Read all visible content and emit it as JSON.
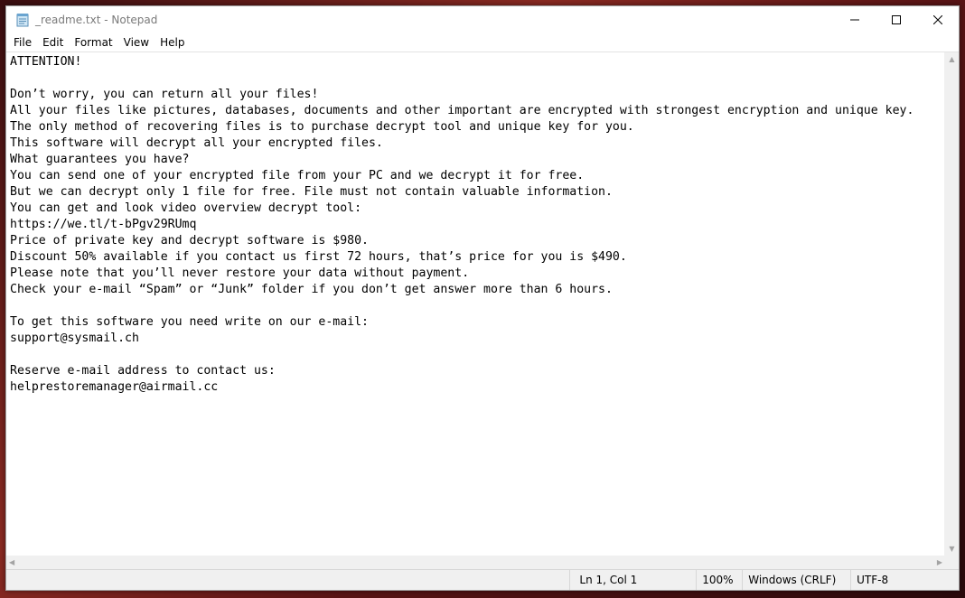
{
  "window": {
    "title": "_readme.txt - Notepad",
    "icon": "notepad-icon",
    "controls": [
      "minimize-icon",
      "maximize-icon",
      "close-icon"
    ]
  },
  "menu": {
    "file": "File",
    "edit": "Edit",
    "format": "Format",
    "view": "View",
    "help": "Help"
  },
  "document": {
    "text": "ATTENTION!\n\nDon’t worry, you can return all your files!\nAll your files like pictures, databases, documents and other important are encrypted with strongest encryption and unique key.\nThe only method of recovering files is to purchase decrypt tool and unique key for you.\nThis software will decrypt all your encrypted files.\nWhat guarantees you have?\nYou can send one of your encrypted file from your PC and we decrypt it for free.\nBut we can decrypt only 1 file for free. File must not contain valuable information.\nYou can get and look video overview decrypt tool:\nhttps://we.tl/t-bPgv29RUmq\nPrice of private key and decrypt software is $980.\nDiscount 50% available if you contact us first 72 hours, that’s price for you is $490.\nPlease note that you’ll never restore your data without payment.\nCheck your e-mail “Spam” or “Junk” folder if you don’t get answer more than 6 hours.\n\nTo get this software you need write on our e-mail:\nsupport@sysmail.ch\n\nReserve e-mail address to contact us:\nhelprestoremanager@airmail.cc"
  },
  "status": {
    "position": "Ln 1, Col 1",
    "zoom": "100%",
    "line_ending": "Windows (CRLF)",
    "encoding": "UTF-8"
  }
}
